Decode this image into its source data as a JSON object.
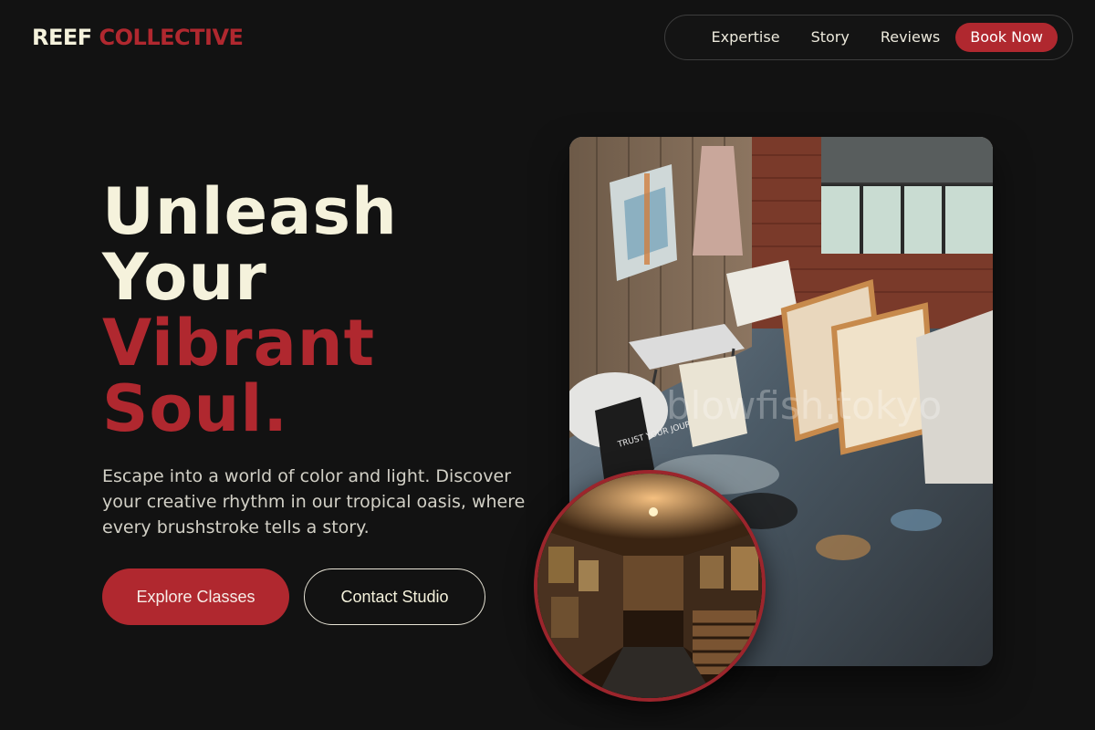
{
  "brand": {
    "part1": "REEF",
    "part2": "COLLECTIVE"
  },
  "nav": {
    "items": [
      "Expertise",
      "Story",
      "Reviews"
    ],
    "cta": "Book Now"
  },
  "hero": {
    "line1": "Unleash",
    "line2": "Your",
    "line3": "Vibrant",
    "line4": "Soul.",
    "description": "Escape into a world of color and light. Discover your creative rhythm in our tropical oasis, where every brushstroke tells a story.",
    "primary_button": "Explore Classes",
    "secondary_button": "Contact Studio"
  },
  "images": {
    "main_watermark": "blowfish.tokyo",
    "sign_text": "TRUST YOUR JOURNEY"
  },
  "colors": {
    "background": "#121212",
    "accent": "#b0282f",
    "cream": "#f5f2dc"
  }
}
